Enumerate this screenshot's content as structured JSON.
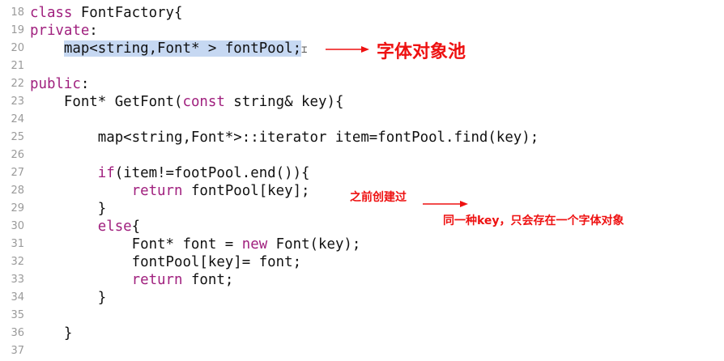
{
  "lines": [
    {
      "n": "18",
      "code": [
        {
          "t": "class",
          "k": "kw"
        },
        {
          "t": " FontFactory{"
        }
      ]
    },
    {
      "n": "19",
      "code": [
        {
          "t": "private",
          "k": "kw"
        },
        {
          "t": ":"
        }
      ]
    },
    {
      "n": "20",
      "code": [
        {
          "t": "    "
        },
        {
          "t": "map<string,Font* > fontPool;",
          "k": "sel"
        }
      ]
    },
    {
      "n": "21",
      "code": []
    },
    {
      "n": "22",
      "code": [
        {
          "t": "public",
          "k": "kw"
        },
        {
          "t": ":"
        }
      ]
    },
    {
      "n": "23",
      "code": [
        {
          "t": "    Font* GetFont("
        },
        {
          "t": "const",
          "k": "kw"
        },
        {
          "t": " string& key){"
        }
      ]
    },
    {
      "n": "24",
      "code": []
    },
    {
      "n": "25",
      "code": [
        {
          "t": "        map<string,Font*>::iterator item=fontPool.find(key);"
        }
      ]
    },
    {
      "n": "26",
      "code": []
    },
    {
      "n": "27",
      "code": [
        {
          "t": "        "
        },
        {
          "t": "if",
          "k": "kw"
        },
        {
          "t": "(item!=footPool.end()){"
        }
      ]
    },
    {
      "n": "28",
      "code": [
        {
          "t": "            "
        },
        {
          "t": "return",
          "k": "kw"
        },
        {
          "t": " fontPool[key];"
        }
      ]
    },
    {
      "n": "29",
      "code": [
        {
          "t": "        }"
        }
      ]
    },
    {
      "n": "30",
      "code": [
        {
          "t": "        "
        },
        {
          "t": "else",
          "k": "kw"
        },
        {
          "t": "{"
        }
      ]
    },
    {
      "n": "31",
      "code": [
        {
          "t": "            Font* font = "
        },
        {
          "t": "new",
          "k": "kw"
        },
        {
          "t": " Font(key);"
        }
      ]
    },
    {
      "n": "32",
      "code": [
        {
          "t": "            fontPool[key]= font;"
        }
      ]
    },
    {
      "n": "33",
      "code": [
        {
          "t": "            "
        },
        {
          "t": "return",
          "k": "kw"
        },
        {
          "t": " font;"
        }
      ]
    },
    {
      "n": "34",
      "code": [
        {
          "t": "        }"
        }
      ]
    },
    {
      "n": "35",
      "code": []
    },
    {
      "n": "36",
      "code": [
        {
          "t": "    }"
        }
      ]
    },
    {
      "n": "37",
      "code": []
    }
  ],
  "annotations": {
    "pool_label": "字体对象池",
    "created_label": "之前创建过",
    "one_key_label": "同一种key，只会存在一个字体对象"
  },
  "colors": {
    "keyword": "#a0207e",
    "selection": "#c6d8f2",
    "annotation": "#ee1111",
    "line_number": "#9a9a9a"
  }
}
